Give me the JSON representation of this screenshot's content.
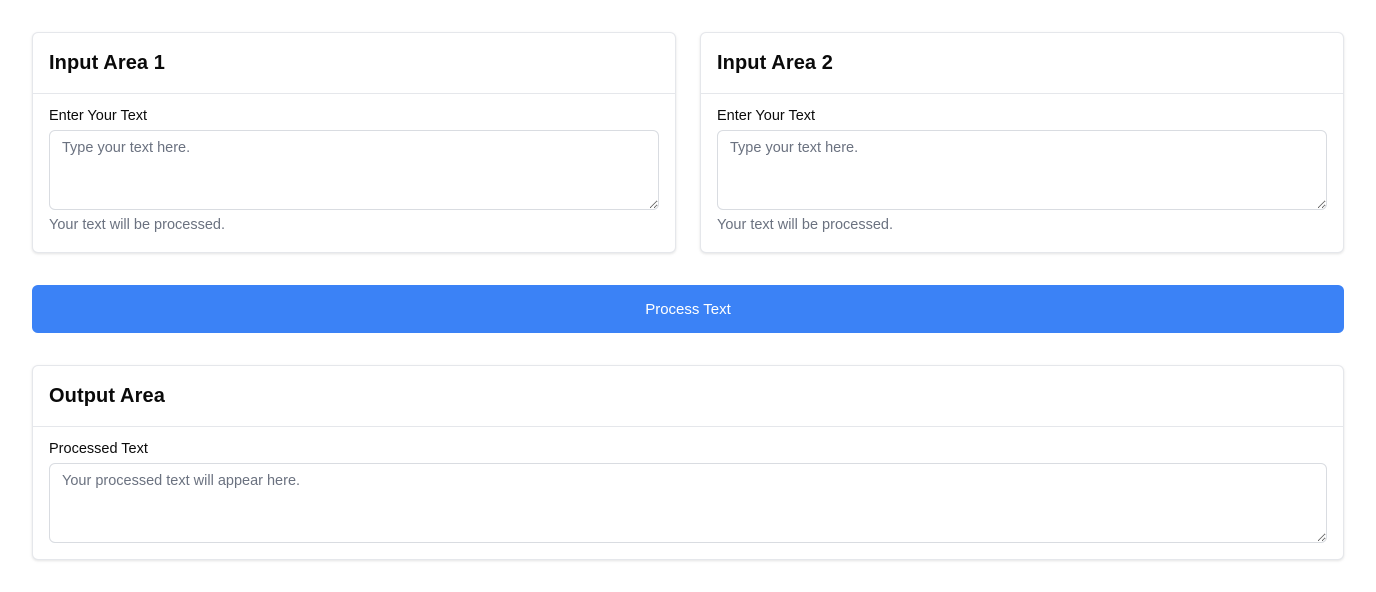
{
  "input_area_1": {
    "title": "Input Area 1",
    "label": "Enter Your Text",
    "placeholder": "Type your text here.",
    "value": "",
    "helper": "Your text will be processed."
  },
  "input_area_2": {
    "title": "Input Area 2",
    "label": "Enter Your Text",
    "placeholder": "Type your text here.",
    "value": "",
    "helper": "Your text will be processed."
  },
  "process_button": {
    "label": "Process Text"
  },
  "output_area": {
    "title": "Output Area",
    "label": "Processed Text",
    "placeholder": "Your processed text will appear here.",
    "value": ""
  },
  "colors": {
    "accent": "#3b82f6",
    "border": "#e5e7eb",
    "muted_text": "#6b7280"
  }
}
